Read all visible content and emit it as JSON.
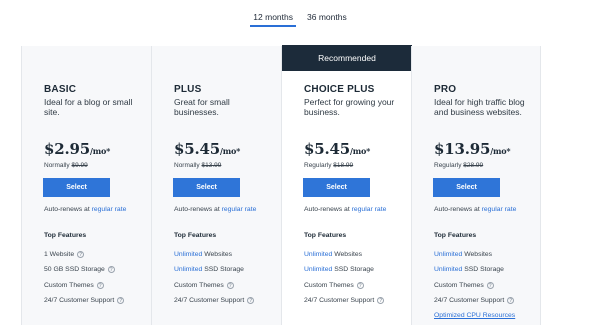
{
  "term_toggle": {
    "options": [
      "12 months",
      "36 months"
    ],
    "selected": "12 months"
  },
  "recommended_label": "Recommended",
  "colors": {
    "accent": "#2f75d8",
    "link": "#2a6fd6",
    "banner": "#1c2b3a",
    "card_bg": "#f7f8fa"
  },
  "plans": [
    {
      "name": "BASIC",
      "desc": "Ideal for a blog or small site.",
      "price": "$2.95",
      "per": "/mo*",
      "normal_label": "Normally",
      "normal_price": "$9.99",
      "select_label": "Select",
      "autorenew_text": "Auto-renews at",
      "autorenew_link": "regular rate",
      "features_title": "Top Features",
      "features": [
        {
          "prefix": "",
          "text": "1 Website"
        },
        {
          "prefix": "",
          "text": "50 GB SSD Storage"
        },
        {
          "prefix": "",
          "text": "Custom Themes"
        },
        {
          "prefix": "",
          "text": "24/7 Customer Support"
        }
      ]
    },
    {
      "name": "PLUS",
      "desc": "Great for small businesses.",
      "price": "$5.45",
      "per": "/mo*",
      "normal_label": "Normally",
      "normal_price": "$13.99",
      "select_label": "Select",
      "autorenew_text": "Auto-renews at",
      "autorenew_link": "regular rate",
      "features_title": "Top Features",
      "features": [
        {
          "prefix": "Unlimited",
          "text": "Websites"
        },
        {
          "prefix": "Unlimited",
          "text": "SSD Storage"
        },
        {
          "prefix": "",
          "text": "Custom Themes"
        },
        {
          "prefix": "",
          "text": "24/7 Customer Support"
        }
      ]
    },
    {
      "name": "CHOICE PLUS",
      "desc": "Perfect for growing your business.",
      "price": "$5.45",
      "per": "/mo*",
      "normal_label": "Regularly",
      "normal_price": "$18.99",
      "select_label": "Select",
      "autorenew_text": "Auto-renews at",
      "autorenew_link": "regular rate",
      "features_title": "Top Features",
      "features": [
        {
          "prefix": "Unlimited",
          "text": "Websites"
        },
        {
          "prefix": "Unlimited",
          "text": "SSD Storage"
        },
        {
          "prefix": "",
          "text": "Custom Themes"
        },
        {
          "prefix": "",
          "text": "24/7 Customer Support"
        }
      ]
    },
    {
      "name": "PRO",
      "desc": "Ideal for high traffic blog and business websites.",
      "price": "$13.95",
      "per": "/mo*",
      "normal_label": "Regularly",
      "normal_price": "$28.99",
      "select_label": "Select",
      "autorenew_text": "Auto-renews at",
      "autorenew_link": "regular rate",
      "features_title": "Top Features",
      "features": [
        {
          "prefix": "Unlimited",
          "text": "Websites"
        },
        {
          "prefix": "Unlimited",
          "text": "SSD Storage"
        },
        {
          "prefix": "",
          "text": "Custom Themes"
        },
        {
          "prefix": "",
          "text": "24/7 Customer Support"
        },
        {
          "prefix": "",
          "text": "Optimized CPU Resources",
          "underlined": true
        }
      ]
    }
  ]
}
